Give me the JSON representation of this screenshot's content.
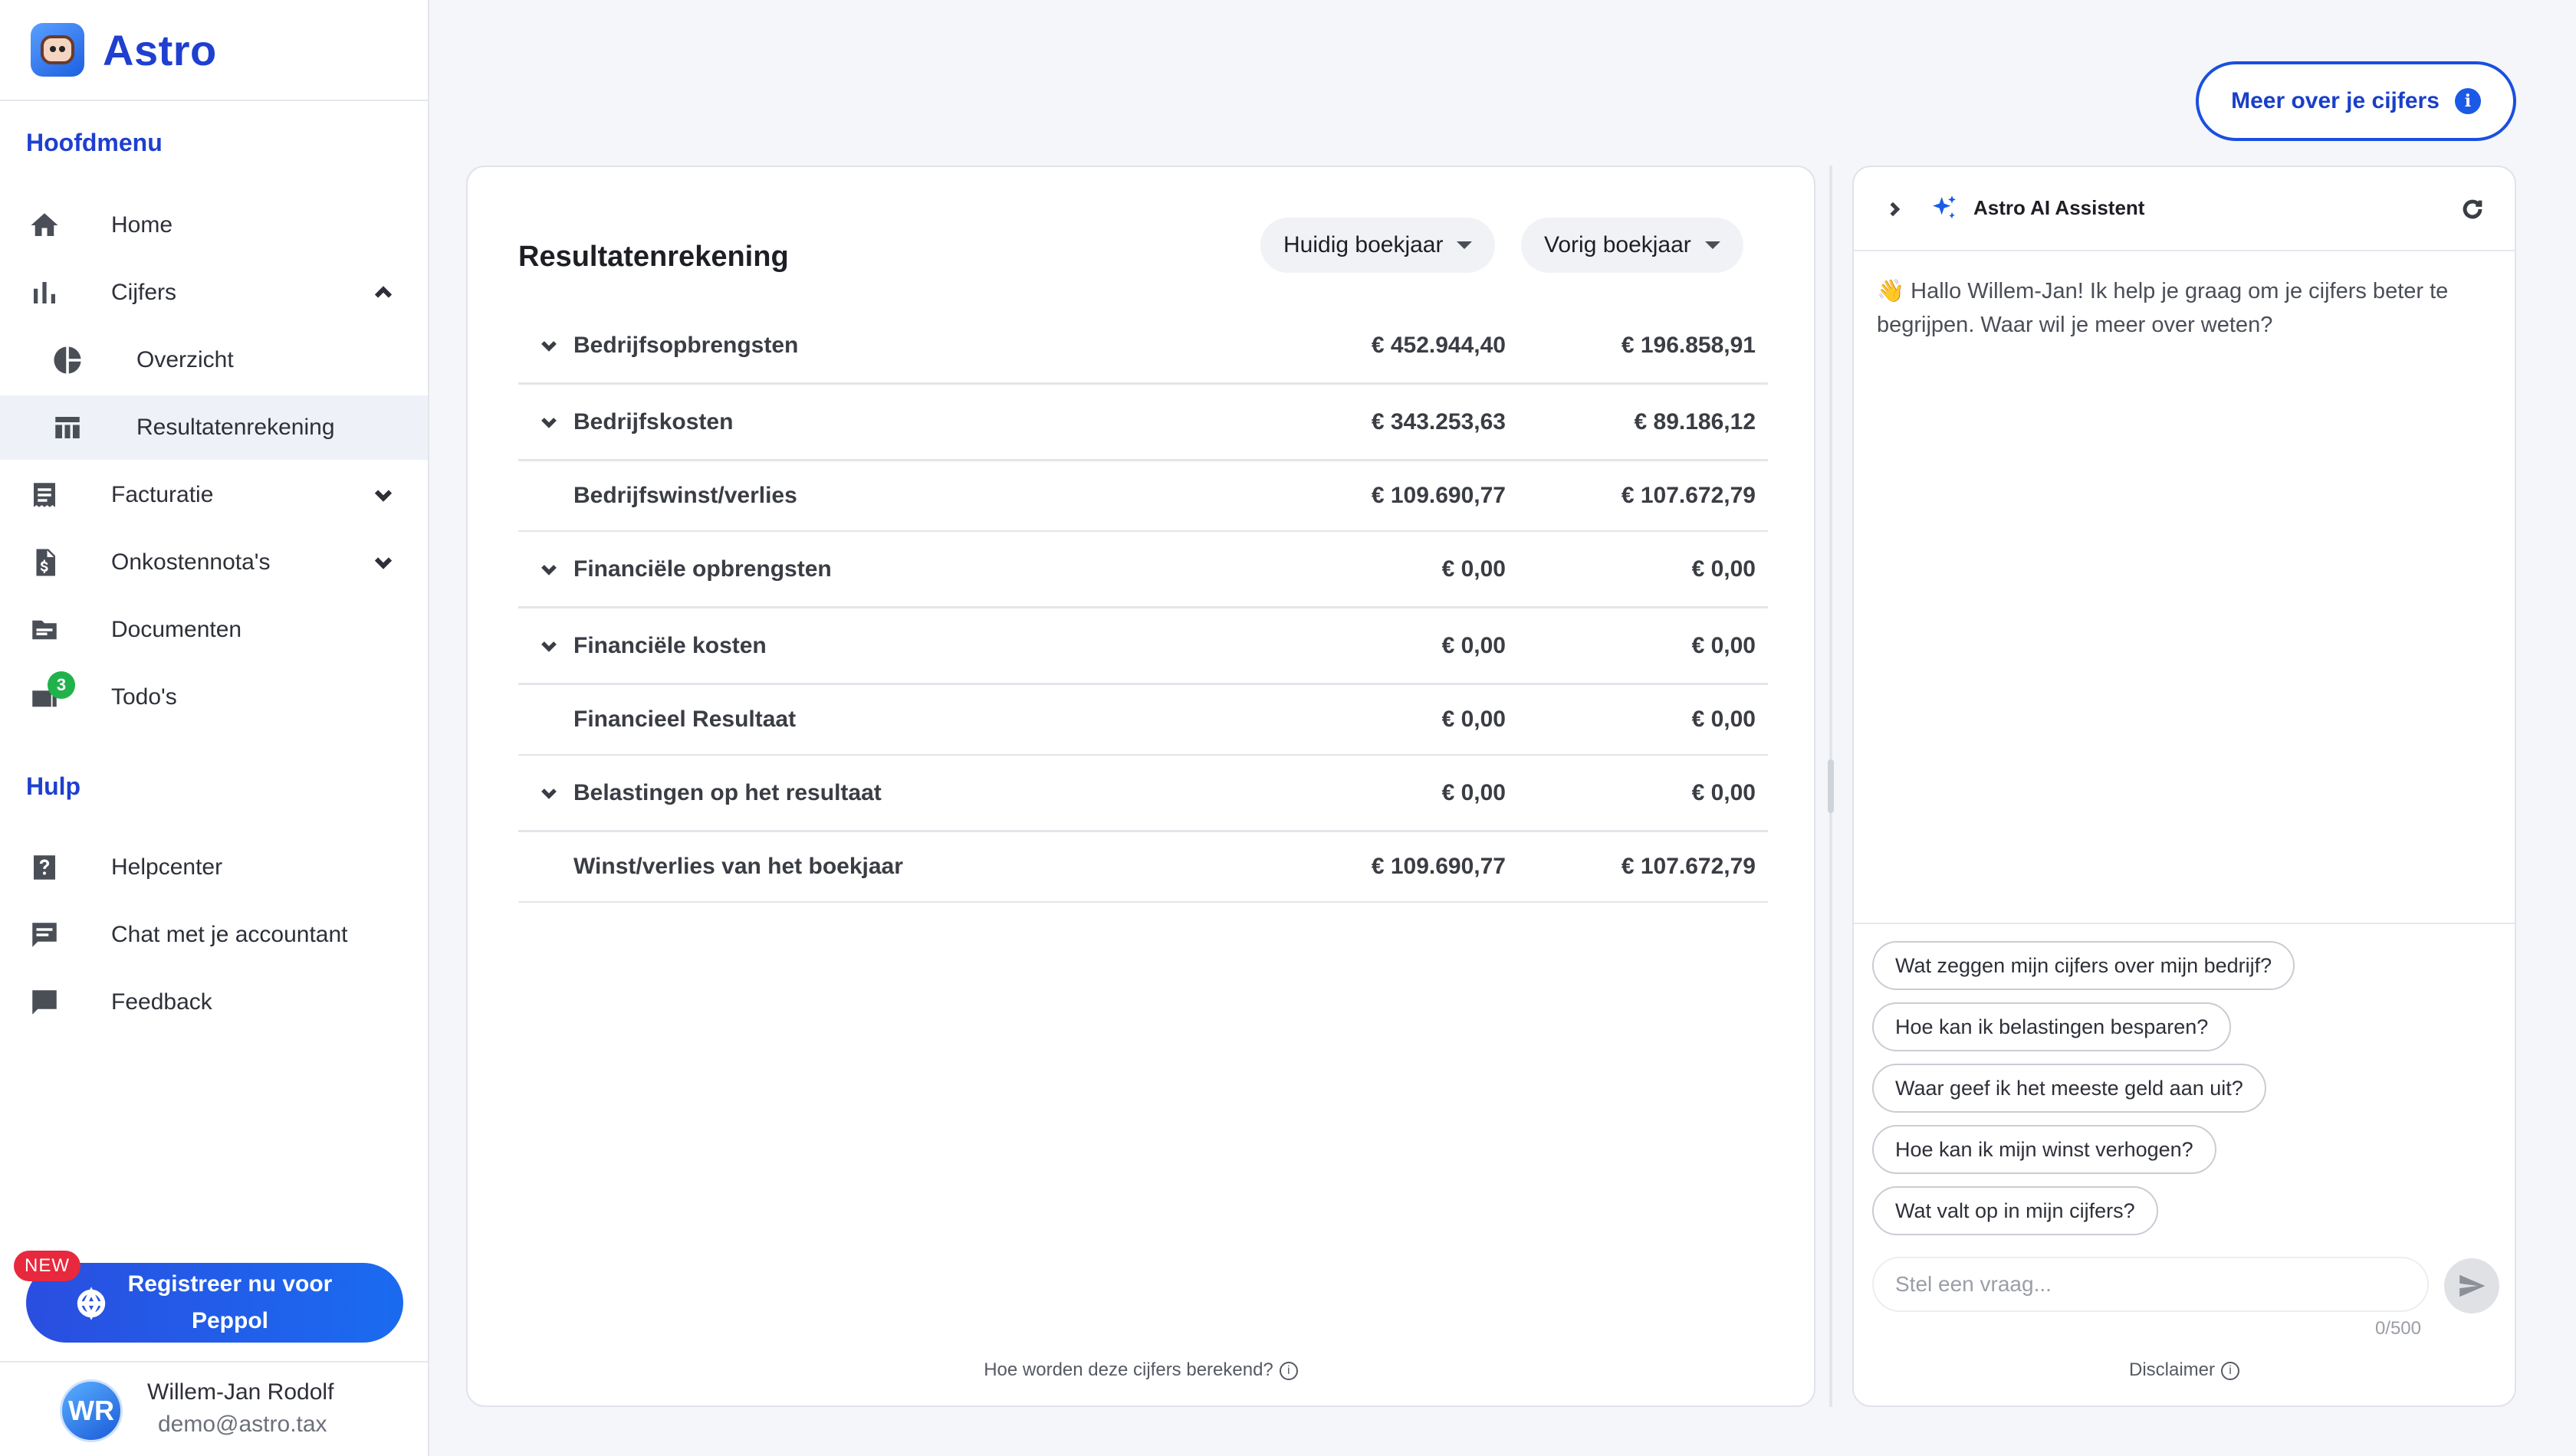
{
  "app": {
    "name": "Astro"
  },
  "sidebar": {
    "main_title": "Hoofdmenu",
    "help_title": "Hulp",
    "items": [
      {
        "label": "Home",
        "icon": "home-icon"
      },
      {
        "label": "Cijfers",
        "icon": "bar-chart-icon",
        "expanded": true
      },
      {
        "label": "Overzicht",
        "icon": "pie-chart-icon"
      },
      {
        "label": "Resultatenrekening",
        "icon": "table-icon",
        "active": true
      },
      {
        "label": "Facturatie",
        "icon": "receipt-icon"
      },
      {
        "label": "Onkostennota's",
        "icon": "expense-doc-icon"
      },
      {
        "label": "Documenten",
        "icon": "folder-icon"
      },
      {
        "label": "Todo's",
        "icon": "inbox-icon",
        "badge": "3"
      }
    ],
    "help_items": [
      {
        "label": "Helpcenter",
        "icon": "help-icon"
      },
      {
        "label": "Chat met je accountant",
        "icon": "chat-icon"
      },
      {
        "label": "Feedback",
        "icon": "feedback-icon"
      }
    ],
    "peppol": {
      "new_badge": "NEW",
      "label": "Registreer nu voor Peppol"
    },
    "user": {
      "initials": "WR",
      "name": "Willem-Jan Rodolf",
      "email": "demo@astro.tax"
    }
  },
  "header": {
    "more_button": "Meer over je cijfers",
    "info_glyph": "i"
  },
  "report": {
    "title": "Resultatenrekening",
    "period_current": "Huidig boekjaar",
    "period_previous": "Vorig boekjaar",
    "rows": [
      {
        "label": "Bedrijfsopbrengsten",
        "current": "€ 452.944,40",
        "previous": "€ 196.858,91",
        "expandable": true
      },
      {
        "label": "Bedrijfskosten",
        "current": "€ 343.253,63",
        "previous": "€ 89.186,12",
        "expandable": true
      },
      {
        "label": "Bedrijfswinst/verlies",
        "current": "€ 109.690,77",
        "previous": "€ 107.672,79",
        "expandable": false
      },
      {
        "label": "Financiële opbrengsten",
        "current": "€ 0,00",
        "previous": "€ 0,00",
        "expandable": true
      },
      {
        "label": "Financiële kosten",
        "current": "€ 0,00",
        "previous": "€ 0,00",
        "expandable": true
      },
      {
        "label": "Financieel Resultaat",
        "current": "€ 0,00",
        "previous": "€ 0,00",
        "expandable": false
      },
      {
        "label": "Belastingen op het resultaat",
        "current": "€ 0,00",
        "previous": "€ 0,00",
        "expandable": true
      },
      {
        "label": "Winst/verlies van het boekjaar",
        "current": "€ 109.690,77",
        "previous": "€ 107.672,79",
        "expandable": false
      }
    ],
    "footer": "Hoe worden deze cijfers berekend?"
  },
  "assistant": {
    "title": "Astro AI Assistent",
    "greeting": "👋 Hallo Willem-Jan! Ik help je graag om je cijfers beter te begrijpen. Waar wil je meer over weten?",
    "suggestions": [
      "Wat zeggen mijn cijfers over mijn bedrijf?",
      "Hoe kan ik belastingen besparen?",
      "Waar geef ik het meeste geld aan uit?",
      "Hoe kan ik mijn winst verhogen?",
      "Wat valt op in mijn cijfers?"
    ],
    "input_placeholder": "Stel een vraag...",
    "counter": "0/500",
    "disclaimer": "Disclaimer"
  },
  "colors": {
    "accent": "#1e3fd0",
    "button": "#1a5ae6",
    "badge_green": "#21b24c",
    "new_red": "#e8283d"
  }
}
